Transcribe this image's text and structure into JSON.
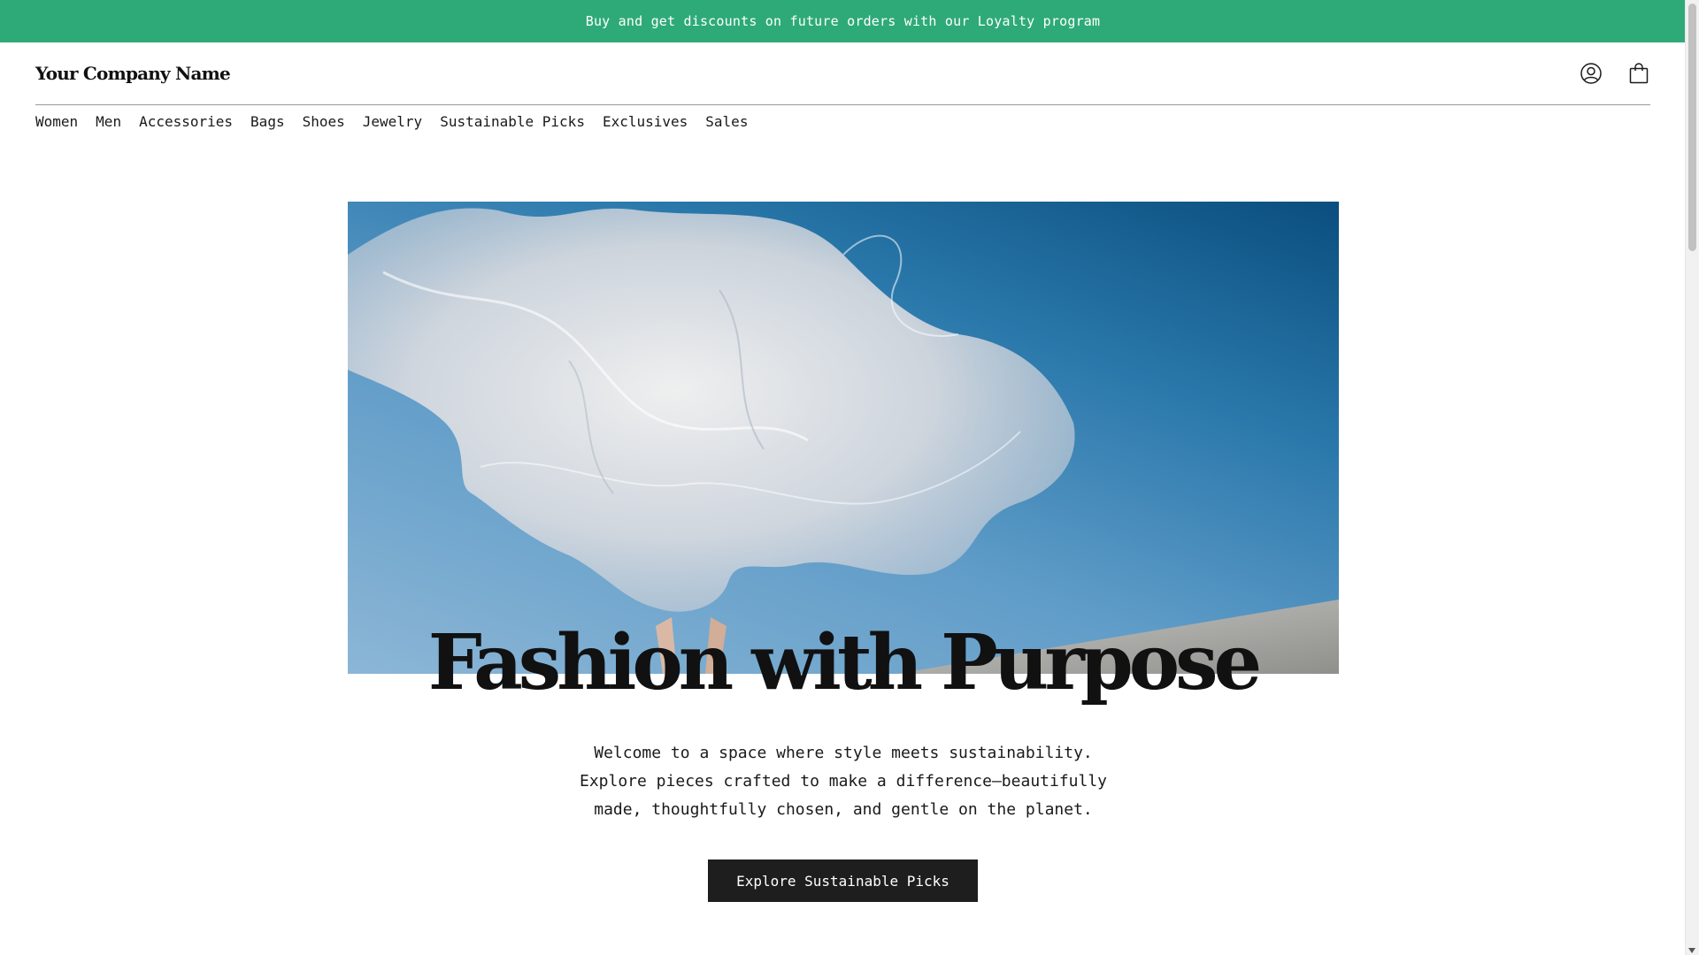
{
  "announcement": {
    "text": "Buy and get discounts on future orders with our Loyalty program"
  },
  "header": {
    "logo": "Your Company Name",
    "icons": [
      "user-account-icon",
      "shopping-bag-icon"
    ]
  },
  "nav": {
    "items": [
      "Women",
      "Men",
      "Accessories",
      "Bags",
      "Shoes",
      "Jewelry",
      "Sustainable Picks",
      "Exclusives",
      "Sales"
    ]
  },
  "hero": {
    "title": "Fashion with Purpose",
    "body": "Welcome to a space where style meets sustainability. Explore pieces crafted to make a difference—beautifully made, thoughtfully chosen, and gentle on the planet.",
    "cta_label": "Explore Sustainable Picks"
  },
  "colors": {
    "announcement_bg": "#2eaa78",
    "button_bg": "#1e1e1e",
    "sky_top": "#0a4e7e",
    "sky_bottom": "#8cb6d6"
  }
}
